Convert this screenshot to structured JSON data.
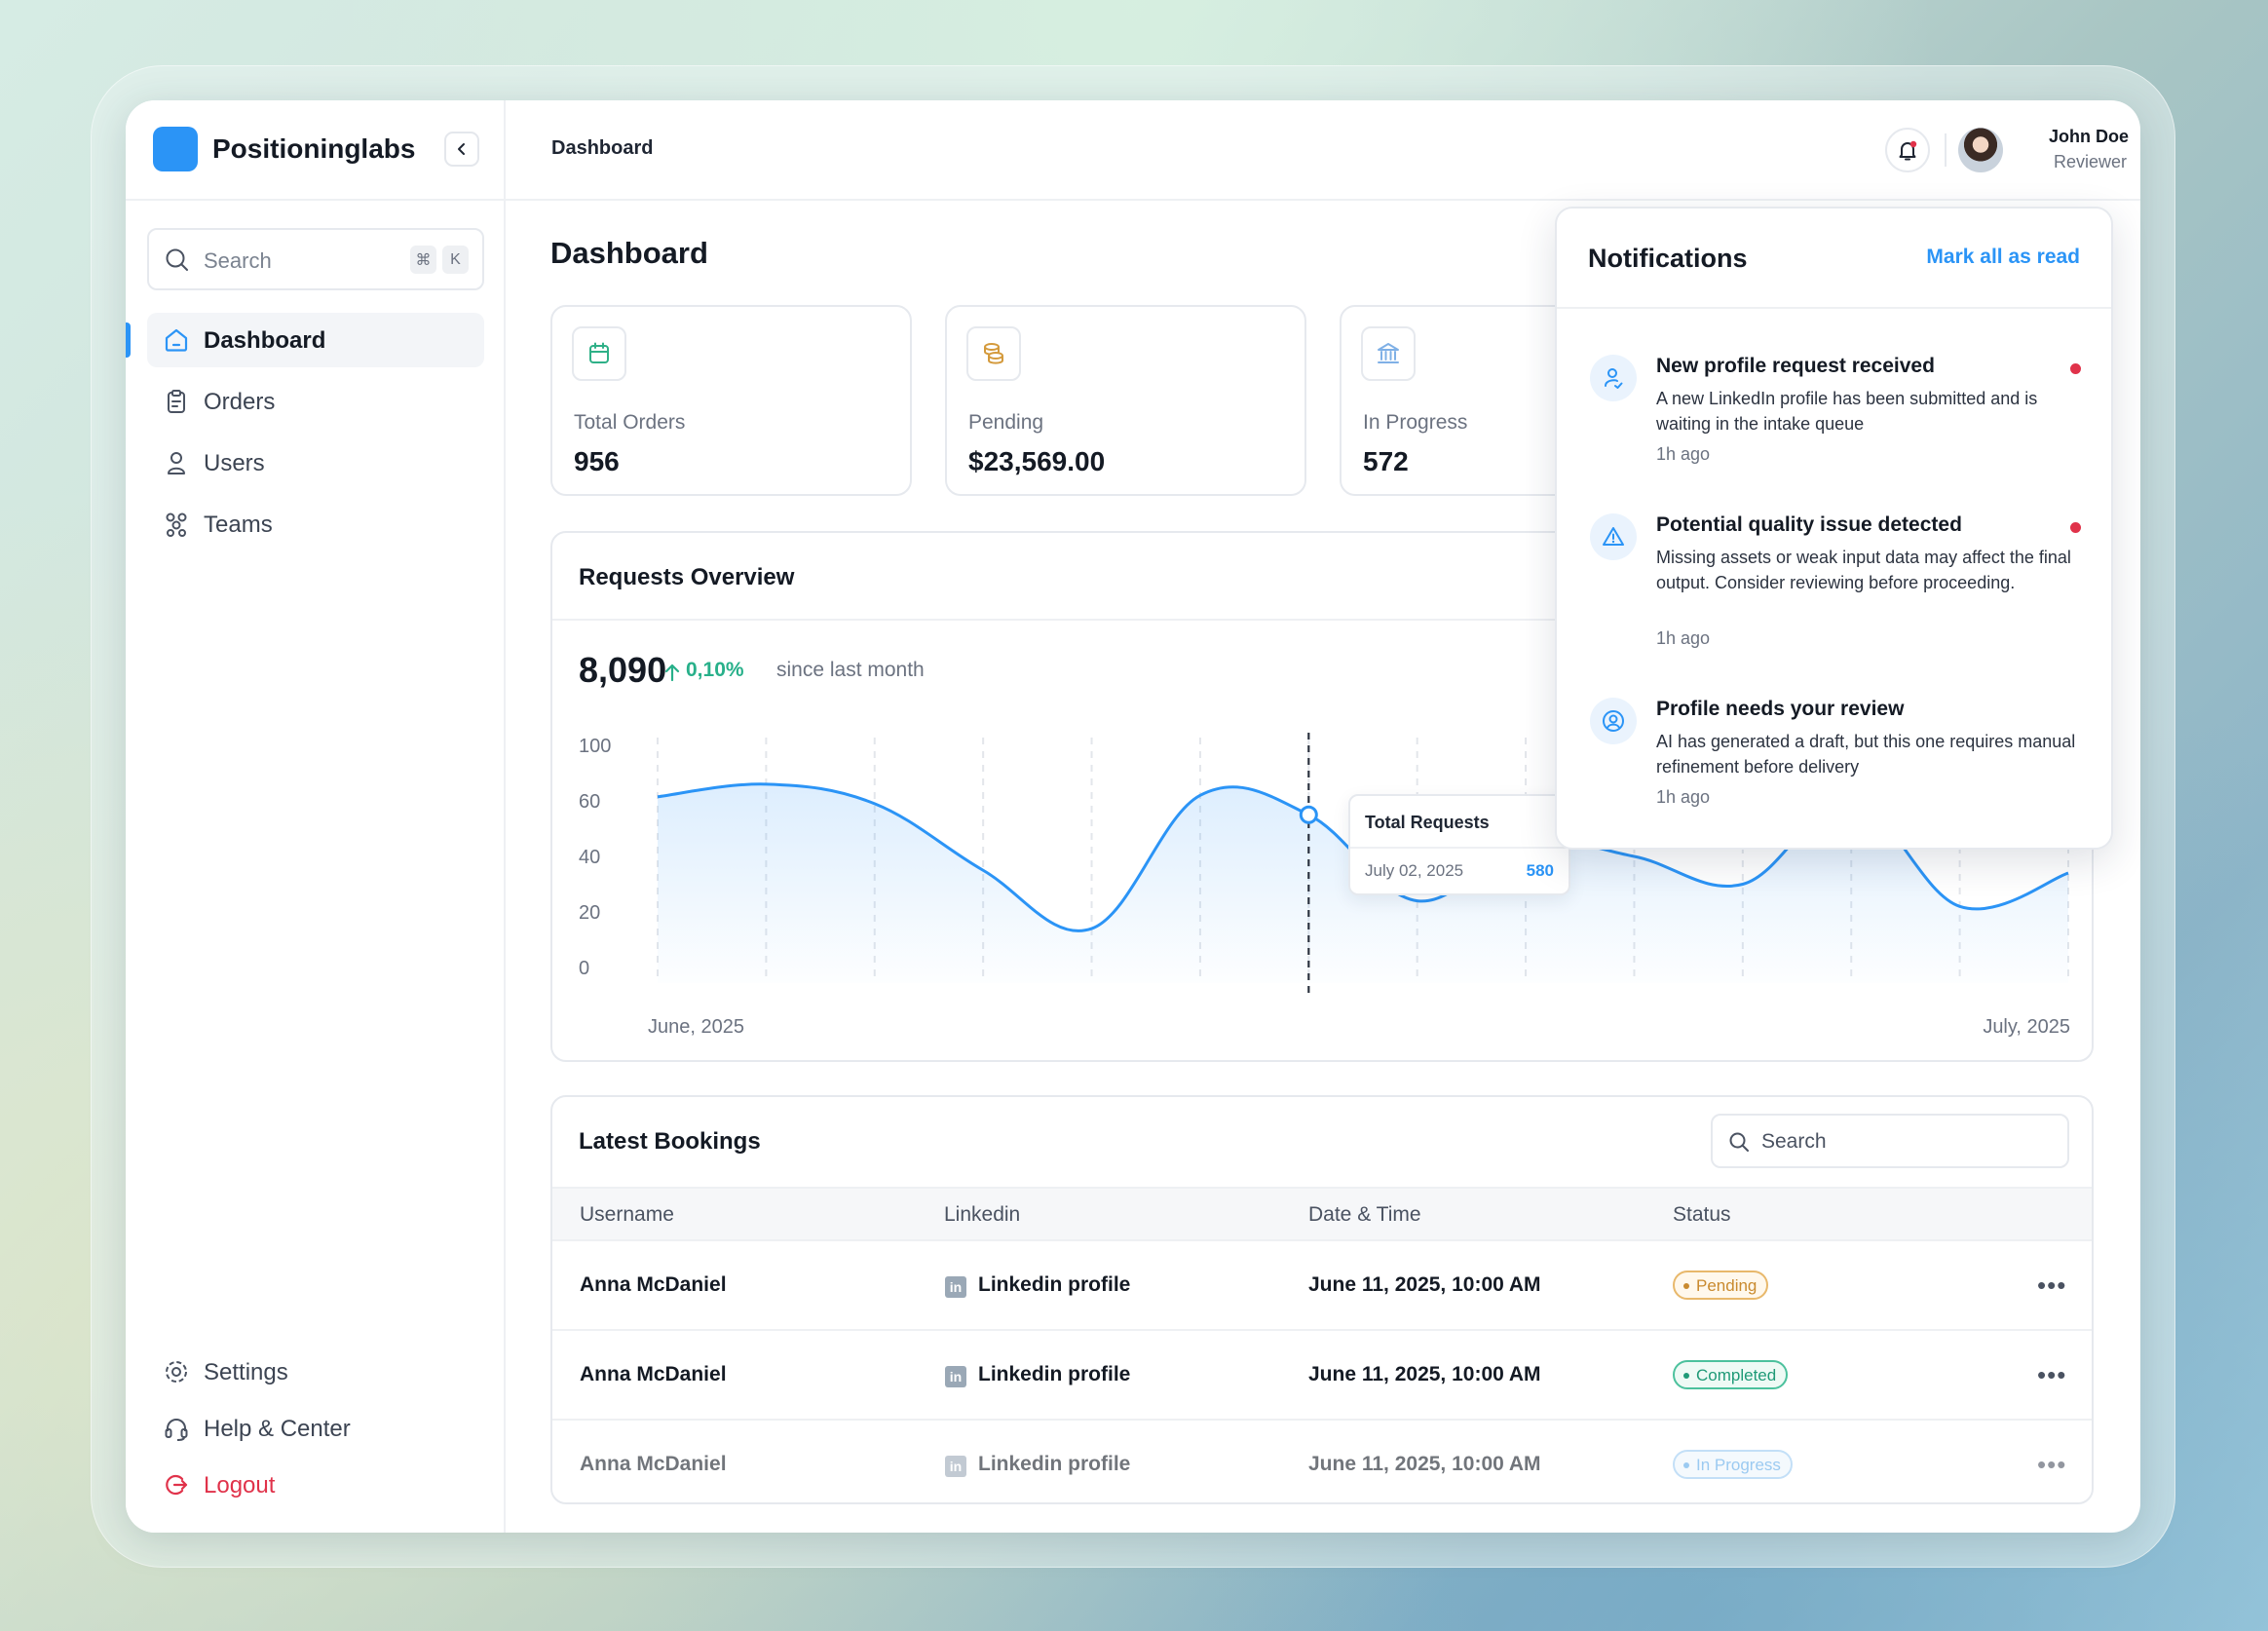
{
  "colors": {
    "accent": "#2b94f6",
    "danger": "#e0324a",
    "success": "#28b08a",
    "pending": "#c98a2e"
  },
  "brand": {
    "name": "Positioninglabs",
    "collapse_icon": "chevron-left-icon"
  },
  "sidebar": {
    "search_placeholder": "Search",
    "shortcut_keys": [
      "⌘",
      "K"
    ],
    "nav": [
      {
        "label": "Dashboard",
        "icon": "home-icon",
        "active": true
      },
      {
        "label": "Orders",
        "icon": "clipboard-icon",
        "active": false
      },
      {
        "label": "Users",
        "icon": "user-icon",
        "active": false
      },
      {
        "label": "Teams",
        "icon": "team-icon",
        "active": false
      }
    ],
    "footer": [
      {
        "label": "Settings",
        "icon": "gear-icon"
      },
      {
        "label": "Help & Center",
        "icon": "headset-icon"
      },
      {
        "label": "Logout",
        "icon": "logout-icon"
      }
    ]
  },
  "header": {
    "breadcrumb": "Dashboard",
    "user": {
      "name": "John Doe",
      "role": "Reviewer"
    }
  },
  "page": {
    "title": "Dashboard"
  },
  "stats": [
    {
      "label": "Total Orders",
      "value": "956",
      "icon": "calendar-icon",
      "icon_color": "#2eb087"
    },
    {
      "label": "Pending",
      "value": "$23,569.00",
      "icon": "coins-icon",
      "icon_color": "#d49a3c"
    },
    {
      "label": "In Progress",
      "value": "572",
      "icon": "bank-icon",
      "icon_color": "#7fb0e6"
    }
  ],
  "requests": {
    "title": "Requests Overview",
    "total": "8,090",
    "delta": "0,10%",
    "delta_note": "since last month",
    "tooltip": {
      "title": "Total Requests",
      "date": "July 02, 2025",
      "value": "580"
    }
  },
  "chart_data": {
    "type": "area",
    "title": "Requests Overview",
    "y_ticks": [
      "100",
      "60",
      "40",
      "20",
      "0"
    ],
    "x_labels": [
      "June, 2025",
      "July, 2025"
    ],
    "ylim": [
      0,
      100
    ],
    "grid": "vertical dashed",
    "series": [
      {
        "x": [
          0,
          1,
          2,
          3,
          4,
          5,
          6,
          7,
          8,
          9,
          10,
          11,
          12,
          13
        ],
        "values": [
          63,
          72,
          59,
          35,
          14,
          64,
          55,
          24,
          45,
          40,
          30,
          60,
          22,
          34
        ]
      }
    ],
    "highlight_index": 6
  },
  "bookings": {
    "title": "Latest Bookings",
    "search_placeholder": "Search",
    "columns": [
      "Username",
      "Linkedin",
      "Date & Time",
      "Status"
    ],
    "rows": [
      {
        "username": "Anna McDaniel",
        "linkedin": "Linkedin profile",
        "datetime": "June 11, 2025, 10:00 AM",
        "status": "Pending"
      },
      {
        "username": "Anna McDaniel",
        "linkedin": "Linkedin profile",
        "datetime": "June 11, 2025, 10:00 AM",
        "status": "Completed"
      },
      {
        "username": "Anna McDaniel",
        "linkedin": "Linkedin profile",
        "datetime": "June 11, 2025, 10:00 AM",
        "status": "In Progress"
      }
    ],
    "more_icon": "more-horizontal-icon",
    "linkedin_icon_text": "in"
  },
  "notifications": {
    "title": "Notifications",
    "mark_all": "Mark all as read",
    "items": [
      {
        "title": "New profile request received",
        "body": "A new LinkedIn profile has been submitted and is waiting in the intake queue",
        "time": "1h ago",
        "unread": true,
        "icon": "user-sync-icon"
      },
      {
        "title": "Potential quality issue detected",
        "body": "Missing assets or weak input data may affect the final output. Consider reviewing before proceeding.",
        "time": "1h ago",
        "unread": true,
        "icon": "warning-icon"
      },
      {
        "title": "Profile needs your review",
        "body": "AI has generated a draft, but this one requires manual refinement before delivery",
        "time": "1h ago",
        "unread": false,
        "icon": "user-circle-icon"
      }
    ]
  }
}
